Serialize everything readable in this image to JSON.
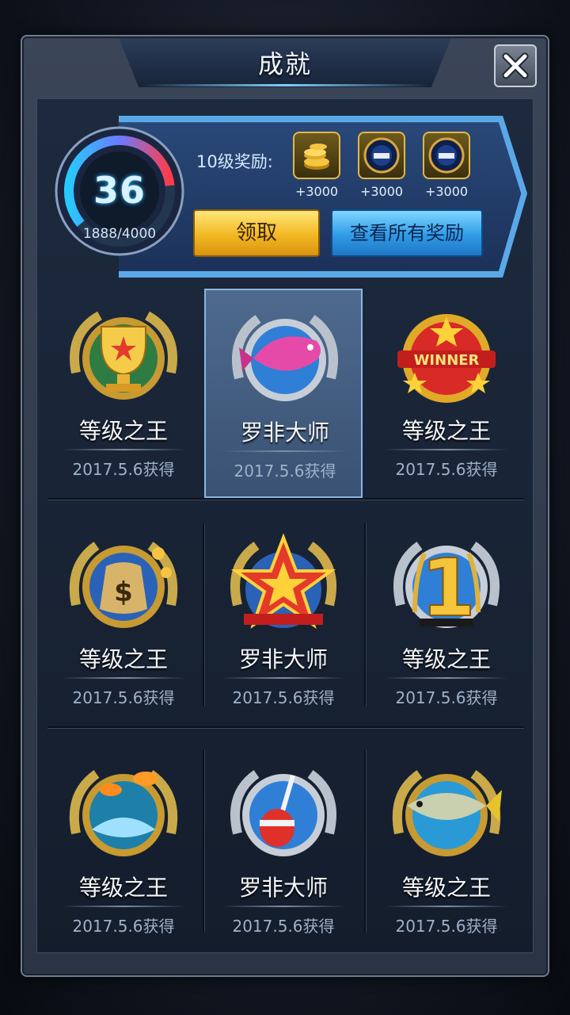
{
  "window": {
    "title": "成就",
    "close_icon": "close-x-icon"
  },
  "level": {
    "value": "36",
    "progress": "1888/4000",
    "progress_fraction": 0.472
  },
  "reward": {
    "label": "10级奖励:",
    "items": [
      {
        "icon": "gold-coins-icon",
        "amount": "+3000"
      },
      {
        "icon": "fishing-reel-icon",
        "amount": "+3000"
      },
      {
        "icon": "fishing-reel-icon",
        "amount": "+3000"
      }
    ]
  },
  "buttons": {
    "claim": "领取",
    "view_all": "查看所有奖励"
  },
  "achievements": [
    {
      "name": "等级之王",
      "date": "2017.5.6获得",
      "icon": "trophy-badge-icon",
      "selected": false
    },
    {
      "name": "罗非大师",
      "date": "2017.5.6获得",
      "icon": "pink-fish-badge-icon",
      "selected": true
    },
    {
      "name": "等级之王",
      "date": "2017.5.6获得",
      "icon": "winner-badge-icon",
      "selected": false
    },
    {
      "name": "等级之王",
      "date": "2017.5.6获得",
      "icon": "money-bag-badge-icon",
      "selected": false
    },
    {
      "name": "罗非大师",
      "date": "2017.5.6获得",
      "icon": "star-badge-icon",
      "selected": false
    },
    {
      "name": "等级之王",
      "date": "2017.5.6获得",
      "icon": "number-one-badge-icon",
      "selected": false
    },
    {
      "name": "等级之王",
      "date": "2017.5.6获得",
      "icon": "goldfish-badge-icon",
      "selected": false
    },
    {
      "name": "罗非大师",
      "date": "2017.5.6获得",
      "icon": "fishing-float-badge-icon",
      "selected": false
    },
    {
      "name": "等级之王",
      "date": "2017.5.6获得",
      "icon": "tuna-badge-icon",
      "selected": false
    }
  ],
  "colors": {
    "accent_blue": "#2f9be6",
    "accent_gold": "#f2b822",
    "panel": "#1d2a3e"
  }
}
